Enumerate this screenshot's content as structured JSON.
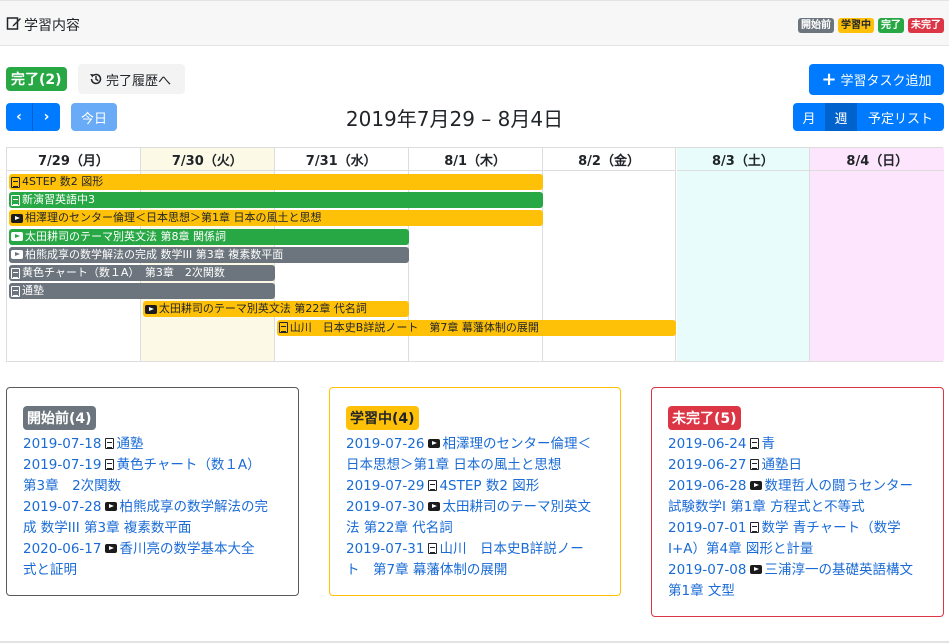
{
  "header": {
    "title": "学習内容",
    "legend": [
      "開始前",
      "学習中",
      "完了",
      "未完了"
    ]
  },
  "toolbar": {
    "done_label": "完了(2)",
    "history_label": "完了履歴へ",
    "add_label": "学習タスク追加",
    "today_label": "今日",
    "range_title": "2019年7月29 – 8月4日",
    "views": [
      "月",
      "週",
      "予定リスト"
    ]
  },
  "calendar": {
    "days": [
      "7/29（月）",
      "7/30（火）",
      "7/31（水）",
      "8/1（木）",
      "8/2（金）",
      "8/3（土）",
      "8/4（日）"
    ],
    "events": [
      {
        "label": "4STEP 数2 図形",
        "icon": "doc-icon",
        "status": "学習中",
        "start": 0,
        "end": 4
      },
      {
        "label": "新演習英語中3",
        "icon": "doc-icon",
        "status": "完了",
        "start": 0,
        "end": 4
      },
      {
        "label": "相澤理のセンター倫理＜日本思想＞第1章 日本の風土と思想",
        "icon": "video-icon",
        "status": "学習中",
        "start": 0,
        "end": 4
      },
      {
        "label": "太田耕司のテーマ別英文法 第8章 関係詞",
        "icon": "video-icon",
        "status": "完了",
        "start": 0,
        "end": 3
      },
      {
        "label": "柏熊成享の数学解法の完成 数学III 第3章 複素数平面",
        "icon": "video-icon",
        "status": "開始前",
        "start": 0,
        "end": 3
      },
      {
        "label": "黄色チャート（数１A）　第3章　2次関数",
        "icon": "doc-icon",
        "status": "開始前",
        "start": 0,
        "end": 2
      },
      {
        "label": "通塾",
        "icon": "doc-icon",
        "status": "開始前",
        "start": 0,
        "end": 2
      },
      {
        "label": "太田耕司のテーマ別英文法 第22章 代名詞",
        "icon": "video-icon",
        "status": "学習中",
        "start": 1,
        "end": 3
      },
      {
        "label": "山川　日本史B詳説ノート　第7章 幕藩体制の展開",
        "icon": "doc-icon",
        "status": "学習中",
        "start": 2,
        "end": 5
      }
    ]
  },
  "cards": [
    {
      "title": "開始前(4)",
      "status": "not-started",
      "items": [
        {
          "date": "2019-07-18",
          "icon": "doc-icon",
          "text": "通塾"
        },
        {
          "date": "2019-07-19",
          "icon": "doc-icon",
          "text": "黄色チャート（数１A）",
          "text2": "第3章　2次関数"
        },
        {
          "date": "2019-07-28",
          "icon": "video-icon",
          "text": "柏熊成享の数学解法の完",
          "text2": "成 数学III 第3章 複素数平面"
        },
        {
          "date": "2020-06-17",
          "icon": "video-icon",
          "text": "香川亮の数学基本大全",
          "text2": "式と証明"
        }
      ]
    },
    {
      "title": "学習中(4)",
      "status": "in-progress",
      "items": [
        {
          "date": "2019-07-26",
          "icon": "video-icon",
          "text": "相澤理のセンター倫理＜",
          "text2": "日本思想＞第1章 日本の風土と思想"
        },
        {
          "date": "2019-07-29",
          "icon": "doc-icon",
          "text": "4STEP 数2 図形"
        },
        {
          "date": "2019-07-30",
          "icon": "video-icon",
          "text": "太田耕司のテーマ別英文",
          "text2": "法 第22章 代名詞"
        },
        {
          "date": "2019-07-31",
          "icon": "doc-icon",
          "text": "山川　日本史B詳説ノー",
          "text2": "ト　第7章 幕藩体制の展開"
        }
      ]
    },
    {
      "title": "未完了(5)",
      "status": "incomplete",
      "items": [
        {
          "date": "2019-06-24",
          "icon": "doc-icon",
          "text": "青"
        },
        {
          "date": "2019-06-27",
          "icon": "doc-icon",
          "text": "通塾日"
        },
        {
          "date": "2019-06-28",
          "icon": "video-icon",
          "text": "数理哲人の闘うセンター",
          "text2": "試験数学I 第1章 方程式と不等式"
        },
        {
          "date": "2019-07-01",
          "icon": "doc-icon",
          "text": "数学 青チャート（数学",
          "text2": "I+A）第4章 図形と計量"
        },
        {
          "date": "2019-07-08",
          "icon": "video-icon",
          "text": "三浦淳一の基礎英語構文",
          "text2": "第1章 文型"
        }
      ]
    }
  ],
  "colors": {
    "primary": "#007bff",
    "done": "#28a745",
    "in_progress": "#ffc107",
    "not_started": "#6c757d",
    "incomplete": "#dc3545",
    "today_bg": "#fcf9e6",
    "saturday_bg": "#e9fcfc",
    "sunday_bg": "#fde6fd"
  }
}
